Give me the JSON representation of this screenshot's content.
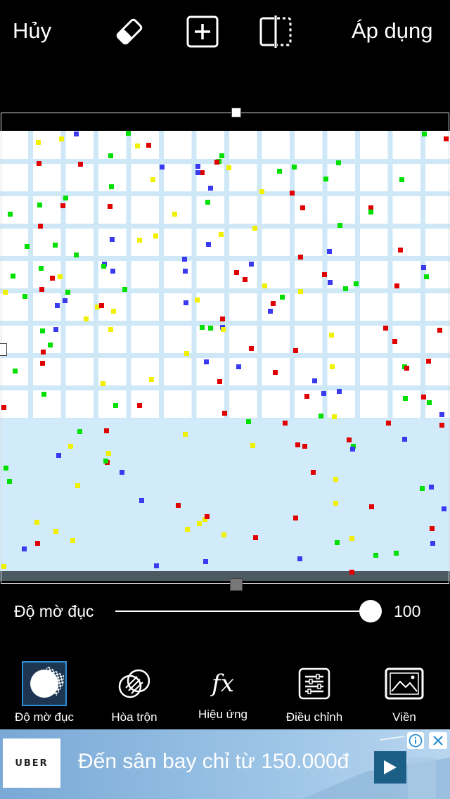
{
  "topbar": {
    "cancel_label": "Hủy",
    "apply_label": "Áp dụng",
    "icons": [
      "eraser-icon",
      "add-icon",
      "flip-icon"
    ]
  },
  "opacity": {
    "label": "Độ mờ đục",
    "value": "100",
    "level": 1.0
  },
  "tools": [
    {
      "label": "Độ mờ đục",
      "icon": "opacity-icon",
      "active": true
    },
    {
      "label": "Hòa trộn",
      "icon": "blend-icon",
      "active": false
    },
    {
      "label": "Hiệu ứng",
      "icon": "fx-icon",
      "active": false
    },
    {
      "label": "Điều chỉnh",
      "icon": "adjust-icon",
      "active": false
    },
    {
      "label": "Viền",
      "icon": "border-image-icon",
      "active": false
    }
  ],
  "ad": {
    "brand": "UBER",
    "text": "Đến sân bay chỉ từ 150.000đ"
  },
  "colors": {
    "grid_line": "#cfe8f7",
    "canvas_light": "#d2ebfb",
    "confetti": [
      "#e00000",
      "#00e000",
      "#f0f000",
      "#3a3af0"
    ],
    "active_tool": "#2d8fd6"
  }
}
